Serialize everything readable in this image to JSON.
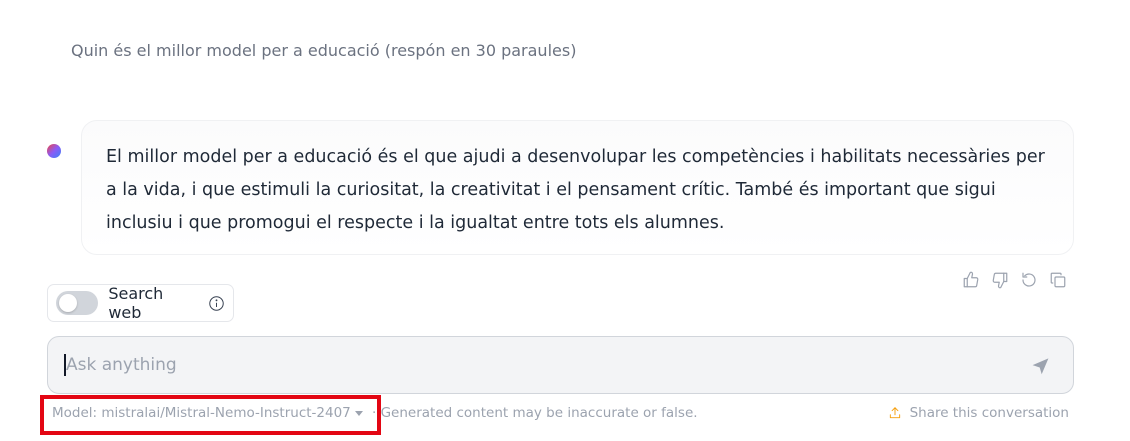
{
  "chat": {
    "user_message": "Quin és el millor model per a educació (respón en 30 paraules)",
    "assistant_message": "El millor model per a educació és el que ajudi a desenvolupar les competències i habilitats necessàries per a la vida, i que estimuli la curiositat, la creativitat i el pensament crític. També és important que sigui inclusiu i que promogui el respecte i la igualtat entre tots els alumnes."
  },
  "message_actions": [
    {
      "icon": "thumbs-up-icon"
    },
    {
      "icon": "thumbs-down-icon"
    },
    {
      "icon": "retry-icon"
    },
    {
      "icon": "copy-icon"
    }
  ],
  "search_web": {
    "label": "Search web",
    "enabled": false
  },
  "composer": {
    "placeholder": "Ask anything",
    "value": ""
  },
  "footer": {
    "model_label": "Model: mistralai/Mistral-Nemo-Instruct-2407",
    "disclaimer": "· Generated content may be inaccurate or false.",
    "share_label": "Share this conversation"
  },
  "colors": {
    "highlight_box": "#e30613",
    "share_icon": "#f59e0b",
    "toggle_off": "#d1d5db"
  }
}
